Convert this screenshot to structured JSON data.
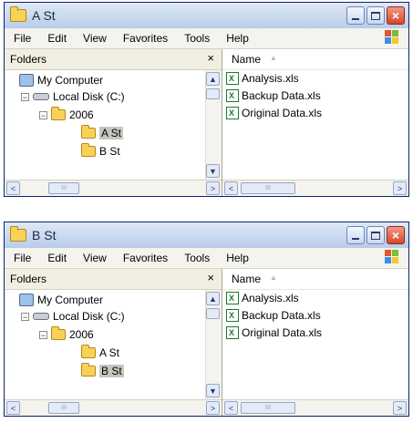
{
  "windows": [
    {
      "title": "A St",
      "menu": [
        "File",
        "Edit",
        "View",
        "Favorites",
        "Tools",
        "Help"
      ],
      "folders_pane": {
        "label": "Folders",
        "close_glyph": "×",
        "tree": [
          "My Computer",
          "Local Disk (C:)",
          "2006",
          "A St",
          "B St"
        ],
        "selected": "A St",
        "collapse_glyph": "−"
      },
      "files_pane": {
        "column": "Name",
        "sort_glyph": "▲",
        "files": [
          "Analysis.xls",
          "Backup Data.xls",
          "Original Data.xls"
        ]
      },
      "scroll": {
        "left": "<",
        "right": ">",
        "up": "^",
        "down": "v",
        "thumb": "III"
      }
    },
    {
      "title": "B St",
      "menu": [
        "File",
        "Edit",
        "View",
        "Favorites",
        "Tools",
        "Help"
      ],
      "folders_pane": {
        "label": "Folders",
        "close_glyph": "×",
        "tree": [
          "My Computer",
          "Local Disk (C:)",
          "2006",
          "A St",
          "B St"
        ],
        "selected": "B St",
        "collapse_glyph": "−"
      },
      "files_pane": {
        "column": "Name",
        "sort_glyph": "▲",
        "files": [
          "Analysis.xls",
          "Backup Data.xls",
          "Original Data.xls"
        ]
      },
      "scroll": {
        "left": "<",
        "right": ">",
        "up": "^",
        "down": "v",
        "thumb": "III"
      }
    }
  ],
  "colors": {
    "titlebar": "#c6d7ee",
    "close_button": "#d4472a",
    "folder": "#f7d257",
    "selection": "#c8c6bd"
  },
  "icons": [
    "folder-icon",
    "my-computer-icon",
    "local-disk-icon",
    "excel-file-icon",
    "windows-logo-icon"
  ]
}
